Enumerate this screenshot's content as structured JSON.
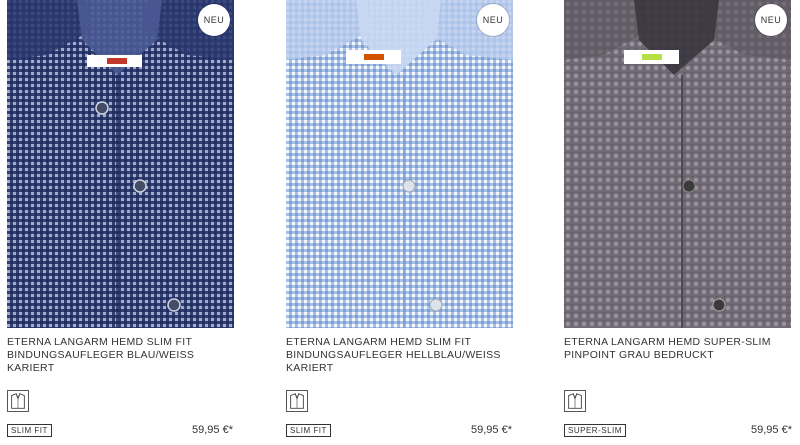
{
  "products": [
    {
      "badge": "NEU",
      "title": "ETERNA Langarm Hemd SLIM FIT Bindungsaufleger blau/weiss kariert",
      "fit_icon": "shirt-collar-icon",
      "fit": "SLIM FIT",
      "price": "59,95 €*",
      "colors": {
        "base": "#3a4a7e",
        "light": "#5565a0",
        "dark": "#1e2a55"
      }
    },
    {
      "badge": "NEU",
      "title": "ETERNA Langarm Hemd SLIM FIT Bindungsaufleger hellblau/weiss kariert",
      "fit_icon": "shirt-collar-icon",
      "fit": "SLIM FIT",
      "price": "59,95 €*",
      "colors": {
        "base": "#9bb6e2",
        "light": "#c3d5f2",
        "dark": "#6f8fc6"
      }
    },
    {
      "badge": "NEU",
      "title": "ETERNA Langarm Hemd SUPER-SLIM Pinpoint grau bedruckt",
      "fit_icon": "shirt-collar-icon",
      "fit": "SUPER-SLIM",
      "price": "59,95 €*",
      "colors": {
        "base": "#6f6a74",
        "light": "#928c96",
        "dark": "#3e3a44"
      }
    }
  ]
}
